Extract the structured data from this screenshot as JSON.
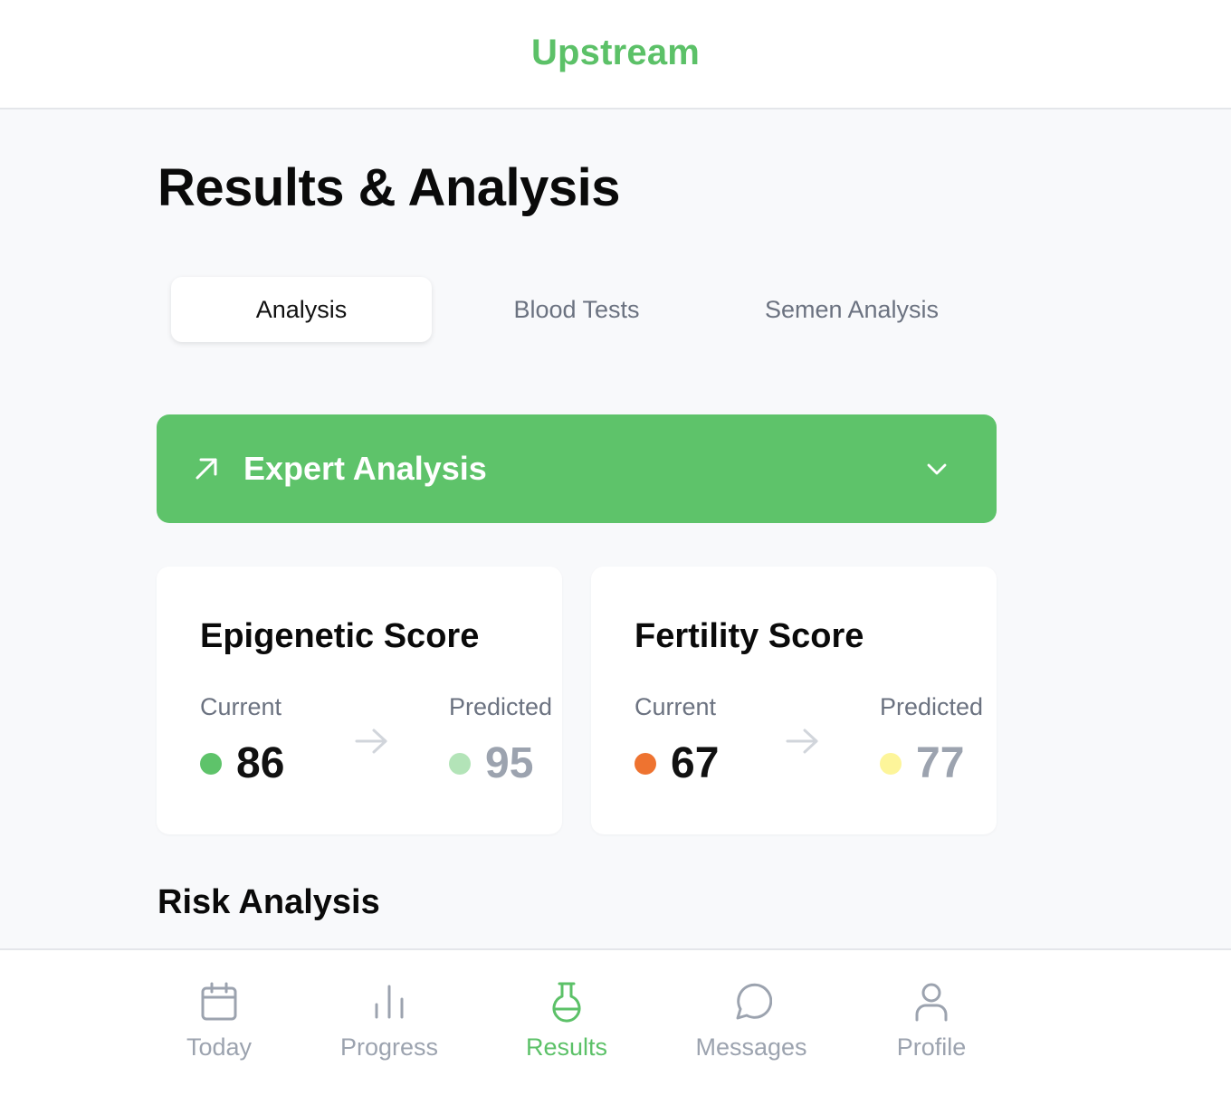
{
  "app": {
    "title": "Upstream"
  },
  "page": {
    "title": "Results & Analysis"
  },
  "tabs": [
    {
      "label": "Analysis",
      "active": true
    },
    {
      "label": "Blood Tests",
      "active": false
    },
    {
      "label": "Semen Analysis",
      "active": false
    }
  ],
  "expert_analysis": {
    "label": "Expert Analysis",
    "icon": "arrow-up-right-icon",
    "toggle_icon": "chevron-down-icon"
  },
  "scores": [
    {
      "title": "Epigenetic Score",
      "current_label": "Current",
      "current_value": "86",
      "current_color": "#5ec36a",
      "predicted_label": "Predicted",
      "predicted_value": "95",
      "predicted_color": "#b3e4b8"
    },
    {
      "title": "Fertility Score",
      "current_label": "Current",
      "current_value": "67",
      "current_color": "#ee7330",
      "predicted_label": "Predicted",
      "predicted_value": "77",
      "predicted_color": "#fdf59a"
    }
  ],
  "risk_analysis": {
    "title": "Risk Analysis"
  },
  "nav": [
    {
      "label": "Today",
      "icon": "calendar-icon",
      "active": false
    },
    {
      "label": "Progress",
      "icon": "bar-chart-icon",
      "active": false
    },
    {
      "label": "Results",
      "icon": "flask-icon",
      "active": true
    },
    {
      "label": "Messages",
      "icon": "message-bubble-icon",
      "active": false
    },
    {
      "label": "Profile",
      "icon": "user-icon",
      "active": false
    }
  ],
  "colors": {
    "brand": "#5cc168",
    "accent_bg": "#5ec36a",
    "muted": "#9ca3af"
  }
}
